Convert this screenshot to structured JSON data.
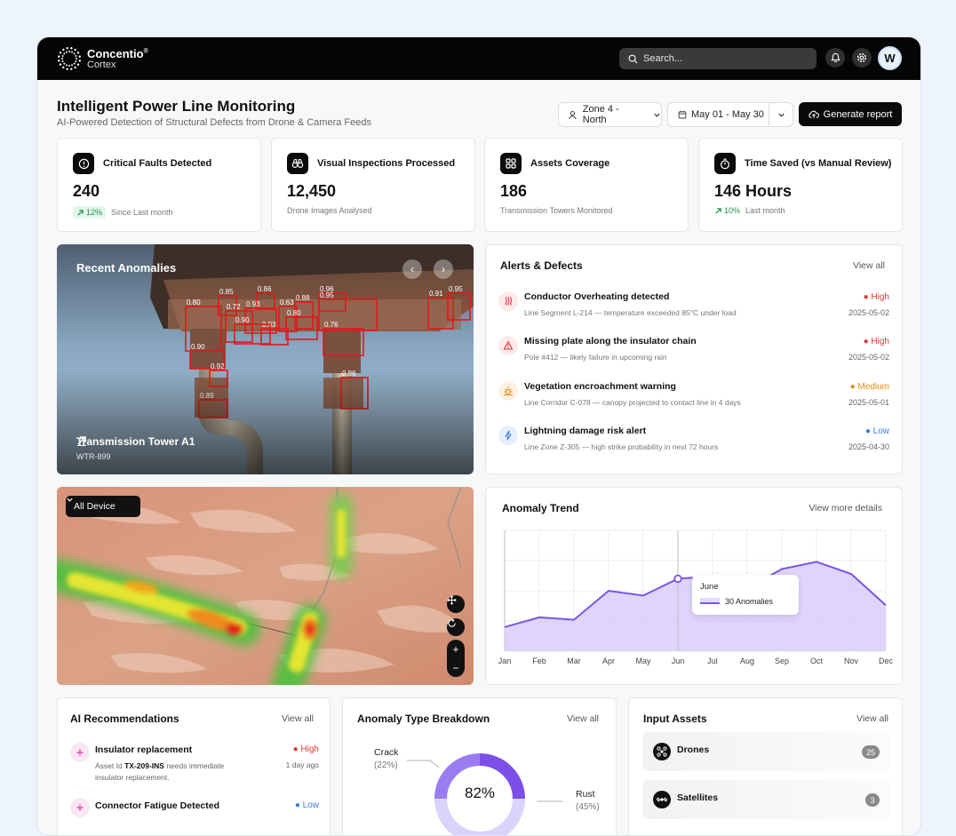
{
  "app": {
    "brand": "Concentio",
    "brand_mark": "®",
    "product": "Cortex"
  },
  "header": {
    "search_placeholder": "Search...",
    "avatar_initial": "W"
  },
  "page": {
    "title": "Intelligent Power Line Monitoring",
    "subtitle": "AI-Powered Detection of Structural Defects from Drone & Camera Feeds",
    "zone": "Zone 4 - North",
    "date_range": "May 01 - May 30",
    "generate_label": "Generate report"
  },
  "stats": [
    {
      "label": "Critical Faults Detected",
      "value": "240",
      "trend": "12%",
      "note": "Since Last month",
      "icon": "alert-circle-icon"
    },
    {
      "label": "Visual Inspections Processed",
      "value": "12,450",
      "note": "Drone Images Analysed",
      "icon": "binoculars-icon"
    },
    {
      "label": "Assets Coverage",
      "value": "186",
      "note": "Transmission Towers Monitored",
      "icon": "grid-icon"
    },
    {
      "label": "Time Saved (vs Manual Review)",
      "value": "146 Hours",
      "trend": "10%",
      "note": "Last month",
      "icon": "stopwatch-icon"
    }
  ],
  "anomalies": {
    "title": "Recent Anomalies",
    "tower_name": "Transmission Tower A1",
    "tower_id": "WTR-899",
    "detections": [
      "0.96",
      "0.85",
      "0.86",
      "0.63",
      "0.88",
      "0.91",
      "0.95",
      "0.80",
      "0.72",
      "0.93",
      "0.80",
      "0.95",
      "0.90",
      "0.76",
      "0.83",
      "0.90",
      "0.92",
      "0.86",
      "0.89"
    ]
  },
  "alerts": {
    "title": "Alerts & Defects",
    "view_all": "View all",
    "items": [
      {
        "title": "Conductor Overheating detected",
        "desc": "Line Segment L-214 — temperature exceeded 85°C under load",
        "severity": "High",
        "date": "2025-05-02",
        "color": "#d93a3a",
        "icon": "heat-icon"
      },
      {
        "title": "Missing plate along the insulator chain",
        "desc": "Pole #412 — likely failure in upcoming rain",
        "severity": "High",
        "date": "2025-05-02",
        "color": "#d93a3a",
        "icon": "warning-burst-icon"
      },
      {
        "title": "Vegetation encroachment warning",
        "desc": "Line Corridor C-078 — canopy projected to contact line in 4 days",
        "severity": "Medium",
        "date": "2025-05-01",
        "color": "#e38b14",
        "icon": "sun-icon"
      },
      {
        "title": "Lightning damage risk alert",
        "desc": "Line Zone Z-305 — high strike probability in next 72 hours",
        "severity": "Low",
        "date": "2025-04-30",
        "color": "#3a7be0",
        "icon": "lightning-icon"
      }
    ]
  },
  "map": {
    "device_filter": "All Device"
  },
  "trend": {
    "title": "Anomaly Trend",
    "view_more": "View more details",
    "tooltip_month": "June",
    "tooltip_value": "30 Anomalies"
  },
  "chart_data": {
    "type": "area",
    "categories": [
      "Jan",
      "Feb",
      "Mar",
      "Apr",
      "May",
      "Jun",
      "Jul",
      "Aug",
      "Sep",
      "Oct",
      "Nov",
      "Dec"
    ],
    "values": [
      10,
      14,
      13,
      25,
      23,
      30,
      31,
      26,
      34,
      37,
      32,
      19
    ],
    "ylim": [
      0,
      50
    ],
    "grid": true,
    "highlight": {
      "category": "Jun",
      "value": 30
    }
  },
  "recommendations": {
    "title": "AI Recommendations",
    "view_all": "View all",
    "items": [
      {
        "title": "Insulator replacement",
        "severity": "High",
        "time": "1 day ago",
        "desc_prefix": "Asset Id ",
        "asset": "TX-209-INS",
        "desc_suffix": " needs immediate",
        "desc_line2": "insulator replacement.",
        "color": "#d93a3a"
      },
      {
        "title": "Connector Fatigue Detected",
        "severity": "Low",
        "color": "#3a7be0"
      }
    ]
  },
  "breakdown": {
    "title": "Anomaly Type Breakdown",
    "view_all": "View all",
    "center_value": "82%",
    "slices": [
      {
        "label": "Crack",
        "pct": "(22%)",
        "value": 22,
        "color": "#9b7bf0"
      },
      {
        "label": "Rust",
        "pct": "(45%)",
        "value": 45,
        "color": "#7b4fe8"
      }
    ]
  },
  "assets": {
    "title": "Input Assets",
    "view_all": "View all",
    "items": [
      {
        "label": "Drones",
        "count": "25",
        "icon": "drone-icon"
      },
      {
        "label": "Satellites",
        "count": "3",
        "icon": "satellite-icon"
      }
    ]
  }
}
